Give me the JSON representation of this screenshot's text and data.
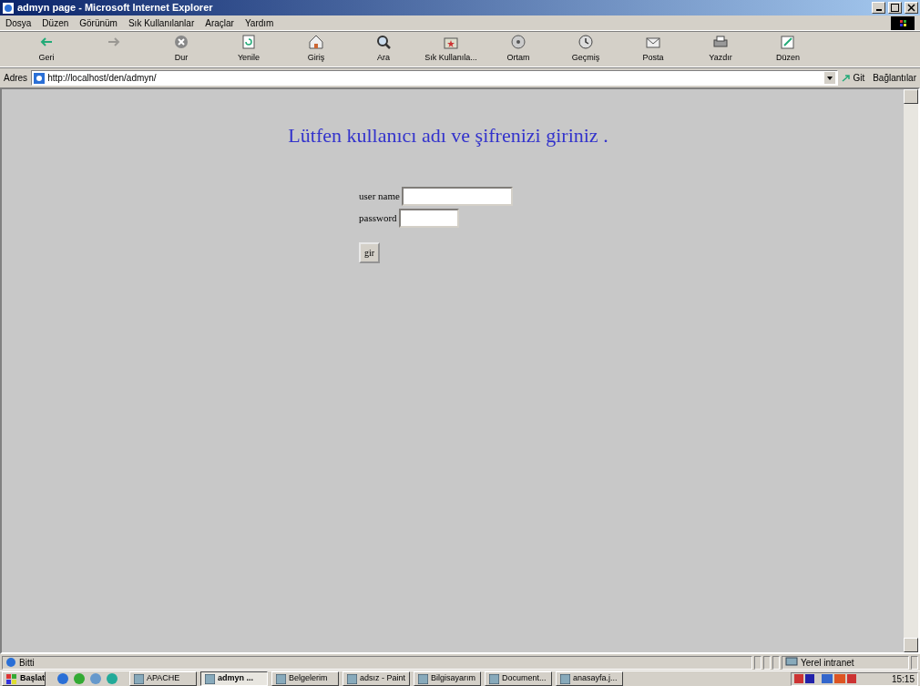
{
  "window": {
    "title": "admyn page - Microsoft Internet Explorer"
  },
  "menu": [
    "Dosya",
    "Düzen",
    "Görünüm",
    "Sık Kullanılanlar",
    "Araçlar",
    "Yardım"
  ],
  "toolbar": [
    {
      "kind": "back",
      "label": "Geri",
      "disabled": false
    },
    {
      "kind": "forward",
      "disabled": true
    },
    {
      "kind": "stop",
      "label": "Dur",
      "disabled": false
    },
    {
      "kind": "refresh",
      "label": "Yenile",
      "disabled": false
    },
    {
      "kind": "home",
      "label": "Giriş",
      "disabled": false
    },
    {
      "kind": "search",
      "label": "Ara",
      "disabled": false
    },
    {
      "kind": "favorites",
      "label": "Sık Kullanıla...",
      "disabled": false
    },
    {
      "kind": "media",
      "label": "Ortam",
      "disabled": false
    },
    {
      "kind": "history",
      "label": "Geçmiş",
      "disabled": false
    },
    {
      "kind": "mail",
      "label": "Posta",
      "disabled": false
    },
    {
      "kind": "print",
      "label": "Yazdır",
      "disabled": false
    },
    {
      "kind": "edit",
      "label": "Düzen",
      "disabled": false
    }
  ],
  "address_bar": {
    "label": "Adres",
    "value": "http://localhost/den/admyn/",
    "go": "Git",
    "links": "Bağlantılar"
  },
  "page": {
    "heading": "Lütfen kullanıcı adı ve şifrenizi giriniz .",
    "fields": [
      {
        "label": "user name",
        "kind": "text"
      },
      {
        "label": "password",
        "kind": "password"
      }
    ],
    "button": "gir"
  },
  "status_bar": {
    "text": "Bitti",
    "zone": "Yerel intranet"
  },
  "taskbar": {
    "start": "Başlat",
    "tasks": [
      {
        "label": "APACHE",
        "selected": false
      },
      {
        "label": "admyn ...",
        "selected": true
      },
      {
        "label": "Belgelerim",
        "selected": false
      },
      {
        "label": "adsız - Paint",
        "selected": false
      },
      {
        "label": "Bilgisayarım",
        "selected": false
      },
      {
        "label": "Document...",
        "selected": false
      },
      {
        "label": "anasayfa.j...",
        "selected": false
      }
    ],
    "clock": "15:15"
  }
}
